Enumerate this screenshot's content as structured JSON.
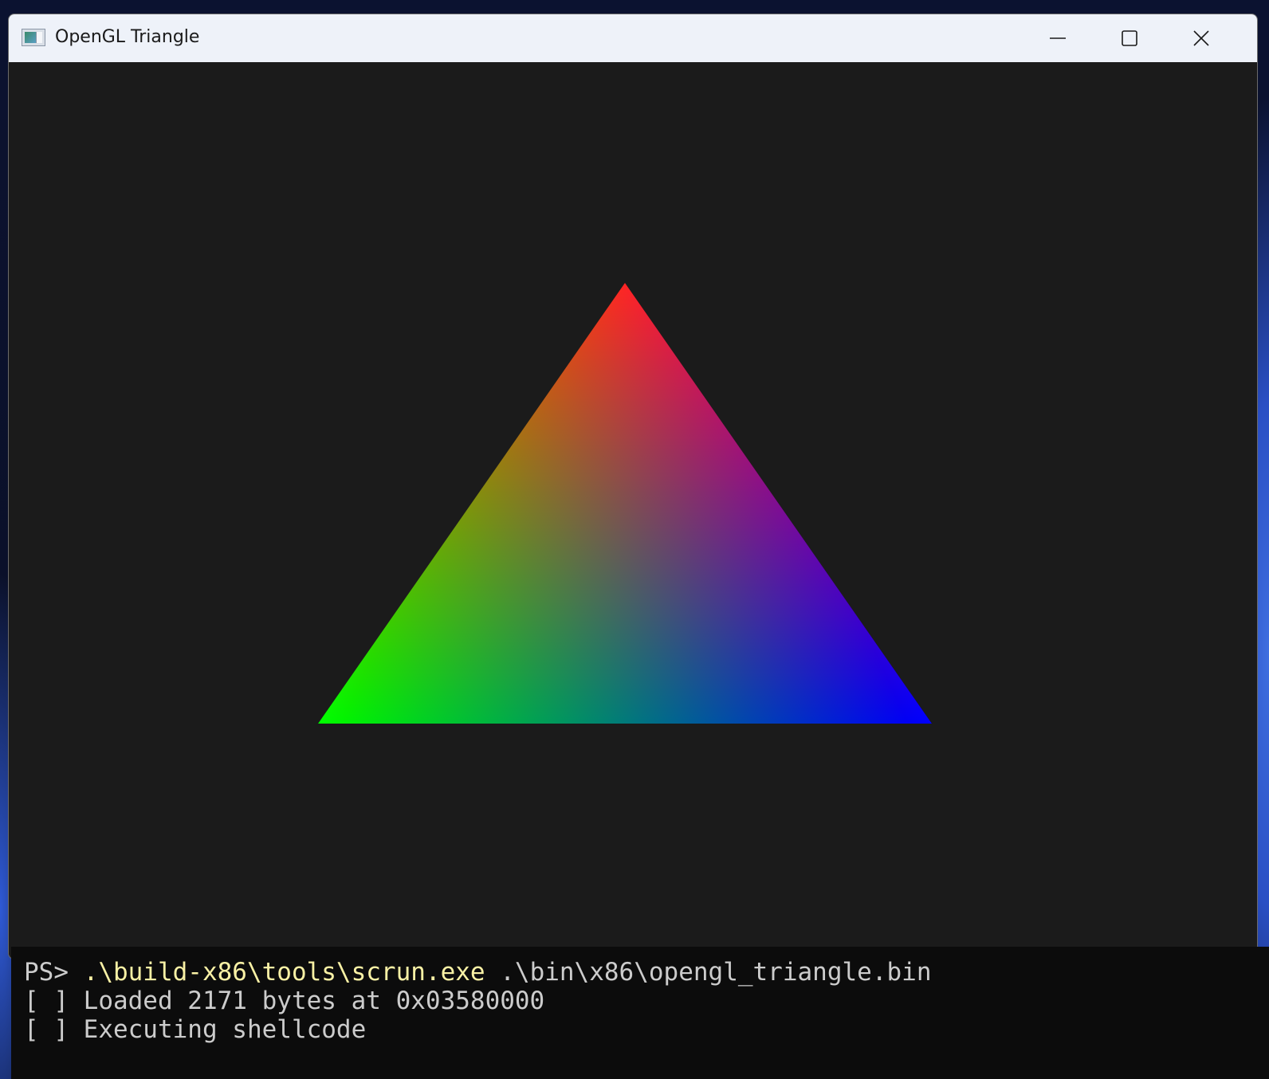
{
  "window": {
    "title": "OpenGL Triangle",
    "icon": "app-window-icon",
    "caption_buttons": [
      "minimize-icon",
      "maximize-icon",
      "close-icon"
    ]
  },
  "canvas": {
    "background": "#1b1b1b",
    "triangle": {
      "colors": {
        "top": "#ff0000",
        "bottom_left": "#00ff00",
        "bottom_right": "#0000ff"
      }
    }
  },
  "terminal": {
    "prompt": "PS> ",
    "command": ".\\build-x86\\tools\\scrun.exe",
    "argument": " .\\bin\\x86\\opengl_triangle.bin",
    "lines": [
      "[ ] Loaded 2171 bytes at 0x03580000",
      "[ ] Executing shellcode"
    ],
    "colors": {
      "text": "#cccccc",
      "command": "#f9f1a5",
      "background": "#0c0c0c"
    }
  }
}
